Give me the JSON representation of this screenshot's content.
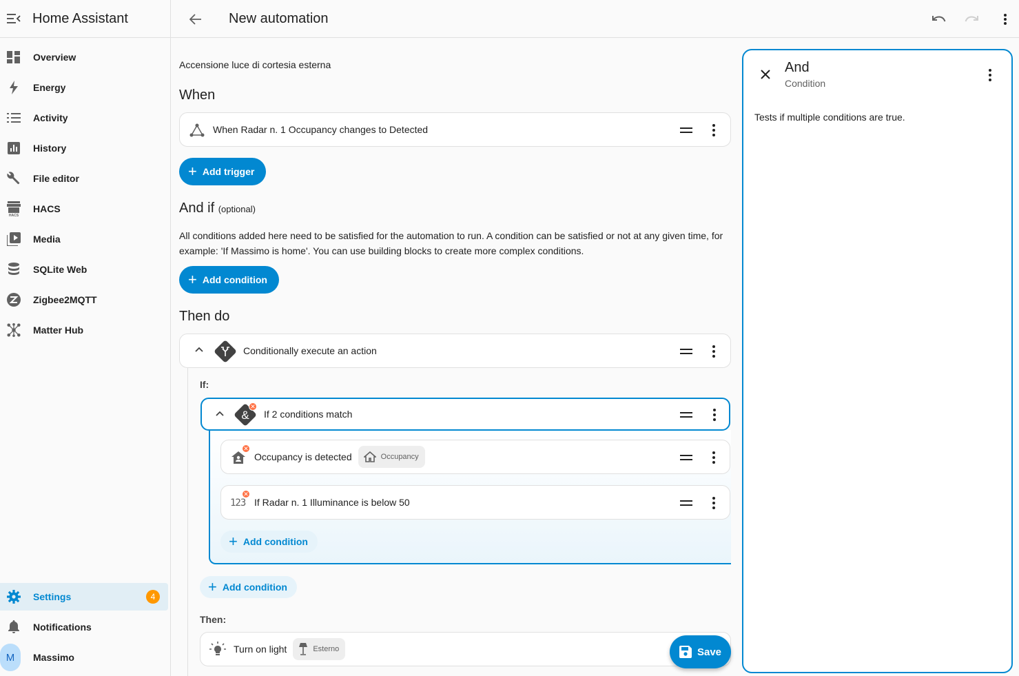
{
  "sidebar": {
    "title": "Home Assistant",
    "items": [
      {
        "label": "Overview",
        "icon": "dashboard-icon"
      },
      {
        "label": "Energy",
        "icon": "lightning-icon"
      },
      {
        "label": "Activity",
        "icon": "list-icon"
      },
      {
        "label": "History",
        "icon": "chart-box-icon"
      },
      {
        "label": "File editor",
        "icon": "wrench-icon"
      },
      {
        "label": "HACS",
        "icon": "hacs-store-icon"
      },
      {
        "label": "Media",
        "icon": "play-box-icon"
      },
      {
        "label": "SQLite Web",
        "icon": "database-icon"
      },
      {
        "label": "Zigbee2MQTT",
        "icon": "zigbee-icon"
      },
      {
        "label": "Matter Hub",
        "icon": "hub-icon"
      }
    ],
    "settings": {
      "label": "Settings",
      "badge": "4"
    },
    "notifications": {
      "label": "Notifications"
    },
    "user": {
      "initial": "M",
      "name": "Massimo"
    }
  },
  "topbar": {
    "title": "New automation"
  },
  "automation": {
    "name": "Accensione luce di cortesia esterna",
    "when": {
      "heading": "When",
      "trigger": "When Radar n. 1 Occupancy changes to Detected",
      "add_label": "Add trigger"
    },
    "and_if": {
      "heading": "And if",
      "optional": "(optional)",
      "desc_line1": "All conditions added here need to be satisfied for the automation to run. A condition can be satisfied or not at any given time, for",
      "desc_line2": "example: 'If Massimo is home'. You can use building blocks to create more complex conditions.",
      "add_label": "Add condition"
    },
    "then_do": {
      "heading": "Then do",
      "action": "Conditionally execute an action",
      "if_label": "If:",
      "group": "If 2 conditions match",
      "conditions": [
        {
          "text": "Occupancy is detected",
          "chip": "Occupancy"
        },
        {
          "text": "If Radar n. 1 Illuminance is below 50"
        }
      ],
      "inner_add": "Add condition",
      "outer_add": "Add condition",
      "then_label": "Then:",
      "then_action": "Turn on light",
      "then_chip": "Esterno"
    }
  },
  "panel": {
    "title": "And",
    "subtitle": "Condition",
    "description": "Tests if multiple conditions are true."
  },
  "save_label": "Save",
  "colors": {
    "accent": "#0288d1",
    "warning": "#ff7043",
    "badge": "#ff9800"
  }
}
